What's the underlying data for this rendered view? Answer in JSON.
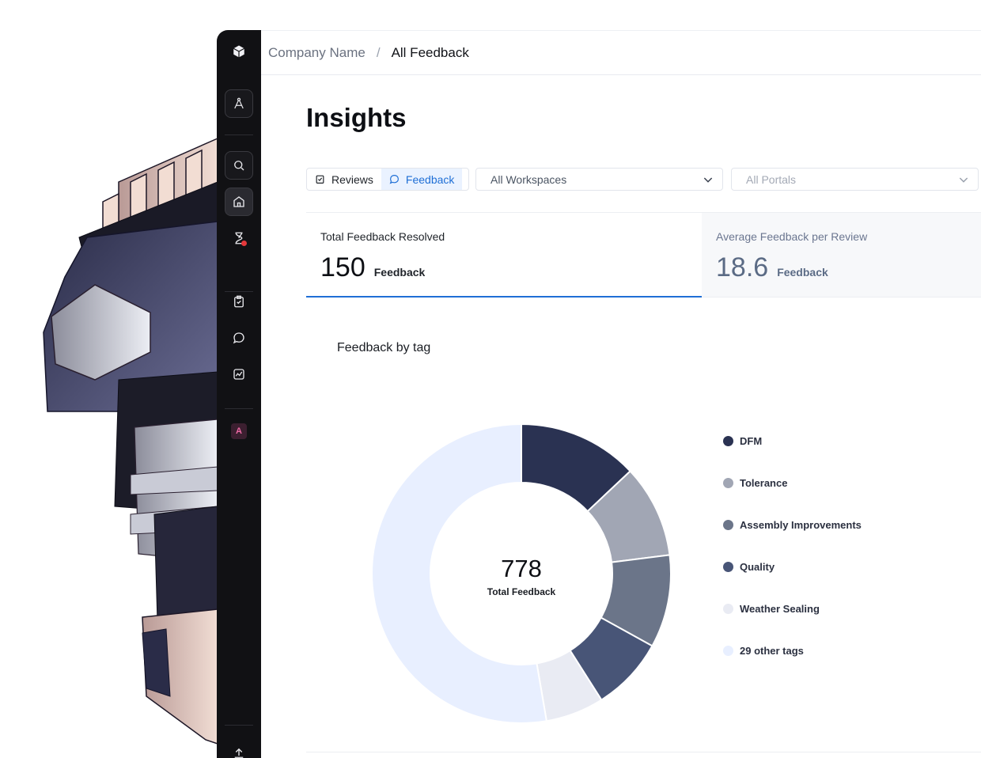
{
  "breadcrumb": {
    "company": "Company Name",
    "separator": "/",
    "current": "All Feedback"
  },
  "page_title": "Insights",
  "view_toggle": {
    "reviews_label": "Reviews",
    "feedback_label": "Feedback",
    "selected": "Feedback"
  },
  "filters": {
    "workspace": "All Workspaces",
    "portal": "All Portals"
  },
  "stats": {
    "resolved": {
      "label": "Total Feedback Resolved",
      "value": "150",
      "unit": "Feedback"
    },
    "average": {
      "label": "Average Feedback per Review",
      "value": "18.6",
      "unit": "Feedback"
    }
  },
  "sidebar": {
    "avatar_letter": "A"
  },
  "icons": [
    "app-logo-icon",
    "compass-icon",
    "search-icon",
    "home-icon",
    "hourglass-icon",
    "clipboard-check-icon",
    "chat-icon",
    "chart-icon",
    "upload-icon"
  ],
  "colors": {
    "accent": "#1f6fd6",
    "sidebar_bg": "#111114",
    "notification": "#e5383b"
  },
  "chart_data": {
    "type": "pie",
    "title": "Feedback by tag",
    "center_value": "778",
    "center_label": "Total Feedback",
    "slices": [
      {
        "label": "DFM",
        "value": 101,
        "color": "#2a3252"
      },
      {
        "label": "Tolerance",
        "value": 78,
        "color": "#a1a6b4"
      },
      {
        "label": "Assembly Improvements",
        "value": 78,
        "color": "#6b7589"
      },
      {
        "label": "Quality",
        "value": 62,
        "color": "#485577"
      },
      {
        "label": "Weather Sealing",
        "value": 49,
        "color": "#e9ebf3"
      },
      {
        "label": "29 other tags",
        "value": 410,
        "color": "#e8efff"
      }
    ]
  }
}
